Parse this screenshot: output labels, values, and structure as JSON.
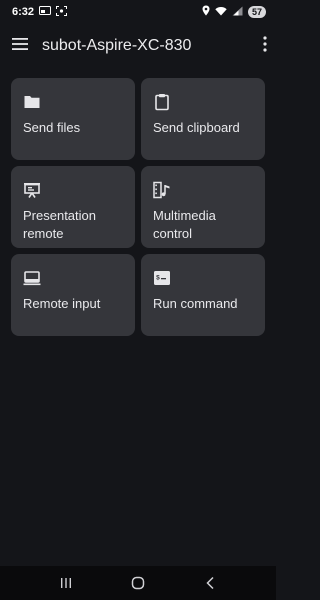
{
  "status_bar": {
    "time": "6:32",
    "battery": "57"
  },
  "app_bar": {
    "title": "subot-Aspire-XC-830"
  },
  "tiles": [
    {
      "label": "Send files",
      "icon": "folder-icon"
    },
    {
      "label": "Send clipboard",
      "icon": "clipboard-icon"
    },
    {
      "label_lines": [
        "Presentation",
        "remote"
      ],
      "icon": "presentation-icon"
    },
    {
      "label_lines": [
        "Multimedia",
        "control"
      ],
      "icon": "multimedia-icon"
    },
    {
      "label": "Remote input",
      "icon": "laptop-icon"
    },
    {
      "label": "Run command",
      "icon": "terminal-icon"
    }
  ],
  "colors": {
    "background": "#141519",
    "tile": "#35363b",
    "text": "#e9e9ec"
  }
}
